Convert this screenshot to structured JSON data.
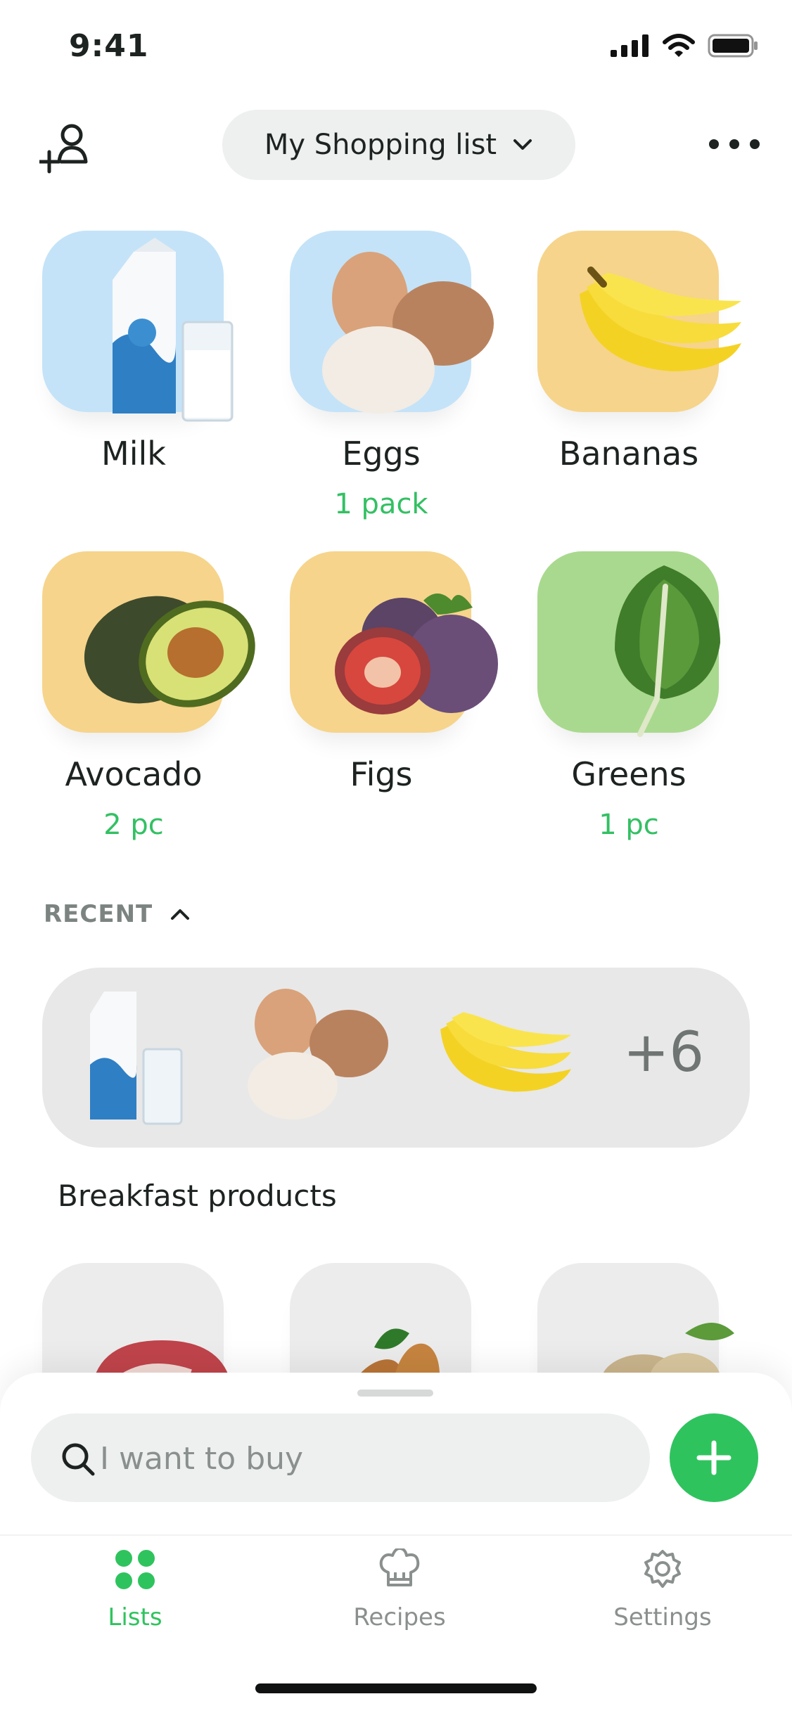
{
  "status_bar": {
    "time": "9:41"
  },
  "header": {
    "list_title": "My Shopping list"
  },
  "items": [
    {
      "name": "Milk",
      "quantity": ""
    },
    {
      "name": "Eggs",
      "quantity": "1 pack"
    },
    {
      "name": "Bananas",
      "quantity": ""
    },
    {
      "name": "Avocado",
      "quantity": "2 pc"
    },
    {
      "name": "Figs",
      "quantity": ""
    },
    {
      "name": "Greens",
      "quantity": "1 pc"
    }
  ],
  "recent": {
    "section_label": "RECENT",
    "more_count": "+6",
    "list_name": "Breakfast products"
  },
  "search": {
    "placeholder": "I want to buy"
  },
  "tabs": [
    {
      "label": "Lists"
    },
    {
      "label": "Recipes"
    },
    {
      "label": "Settings"
    }
  ],
  "colors": {
    "accent": "#2fc35e",
    "quantity_text": "#33c063",
    "tile_blue": "#c4e3f8",
    "tile_yellow": "#f6d48b",
    "tile_green": "#a9d98e",
    "inactive_tab": "#8a908d"
  },
  "icons": [
    "signal-icon",
    "wifi-icon",
    "battery-icon",
    "add-user-icon",
    "chevron-down-icon",
    "more-icon",
    "chevron-up-icon",
    "search-icon",
    "plus-icon",
    "grid-icon",
    "chef-hat-icon",
    "gear-icon"
  ]
}
